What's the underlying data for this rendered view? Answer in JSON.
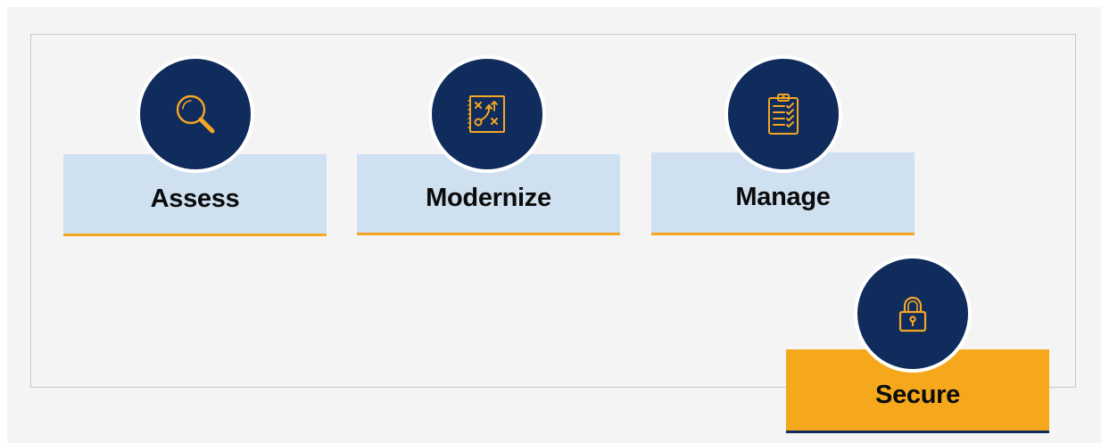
{
  "diagram": {
    "steps": [
      {
        "label": "Assess",
        "icon": "magnifier-icon"
      },
      {
        "label": "Modernize",
        "icon": "strategy-board-icon"
      },
      {
        "label": "Manage",
        "icon": "clipboard-checklist-icon"
      },
      {
        "label": "Secure",
        "icon": "padlock-icon"
      }
    ]
  },
  "colors": {
    "circle_fill": "#0f2c5c",
    "icon_stroke": "#f5a623",
    "card_fill": "#cfe0f1",
    "accent": "#f5a623",
    "secure_card_fill": "#f5a81c"
  }
}
